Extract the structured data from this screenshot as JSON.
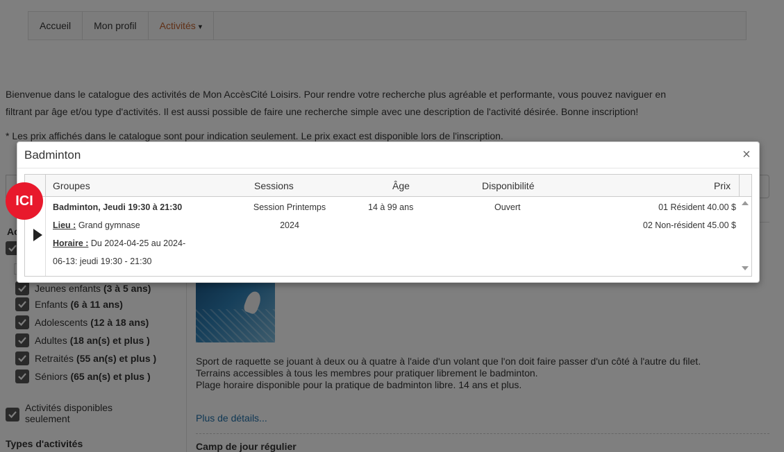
{
  "nav": {
    "items": [
      "Accueil",
      "Mon profil"
    ],
    "active_label": "Activités",
    "active_caret": "▾",
    "accent_color": "#c0602c"
  },
  "intro": {
    "line1": "Bienvenue dans le catalogue des activités de Mon AccèsCité Loisirs. Pour rendre votre recherche plus agréable et performante, vous pouvez naviguer en",
    "line2": "filtrant par âge et/ou type d'activités. Il est aussi possible de faire une recherche simple avec une description de l'activité désirée. Bonne inscription!",
    "note": "* Les prix affichés dans le catalogue sont pour indication seulement. Le prix exact est disponible lors de l'inscription."
  },
  "sidebar": {
    "title_partial": "Ac",
    "age_filters": [
      {
        "label": "Jeunes enfants",
        "range": "(3 à 5 ans)"
      },
      {
        "label": "Enfants",
        "range": "(6 à 11 ans)"
      },
      {
        "label": "Adolescents",
        "range": "(12 à 18 ans)"
      },
      {
        "label": "Adultes",
        "range": "(18 an(s) et plus )"
      },
      {
        "label": "Retraités",
        "range": "(55 an(s) et plus )"
      },
      {
        "label": "Séniors",
        "range": "(65 an(s) et plus )"
      }
    ],
    "available_line1": "Activités disponibles",
    "available_line2": "seulement",
    "types_title": "Types d'activités"
  },
  "content": {
    "description_line1": "Sport de raquette se jouant à deux ou à quatre à l'aide d'un volant que l'on doit faire passer d'un côté à l'autre du filet.",
    "description_line2": "Terrains accessibles à tous les membres pour pratiquer librement le badminton.",
    "description_line3": "Plage horaire disponible pour la pratique de badminton libre. 14 ans et plus.",
    "more_link": "Plus de détails...",
    "next_title": "Camp de jour régulier"
  },
  "modal": {
    "title": "Badminton",
    "close_symbol": "×",
    "columns": [
      "Groupes",
      "Sessions",
      "Âge",
      "Disponibilité",
      "Prix"
    ],
    "row": {
      "group_title": "Badminton, Jeudi 19:30 à 21:30",
      "lieu_label": "Lieu :",
      "lieu_value": "Grand gymnase",
      "horaire_label": "Horaire :",
      "horaire_value1": "Du 2024-04-25 au 2024-",
      "horaire_value2": "06-13: jeudi 19:30 - 21:30",
      "session_line1": "Session Printemps",
      "session_line2": "2024",
      "age": "14 à 99 ans",
      "availability": "Ouvert",
      "price1": "01 Résident 40.00 $",
      "price2": "02 Non-résident 45.00 $"
    }
  },
  "badge": {
    "text": "ICI",
    "color": "#e8192c"
  }
}
